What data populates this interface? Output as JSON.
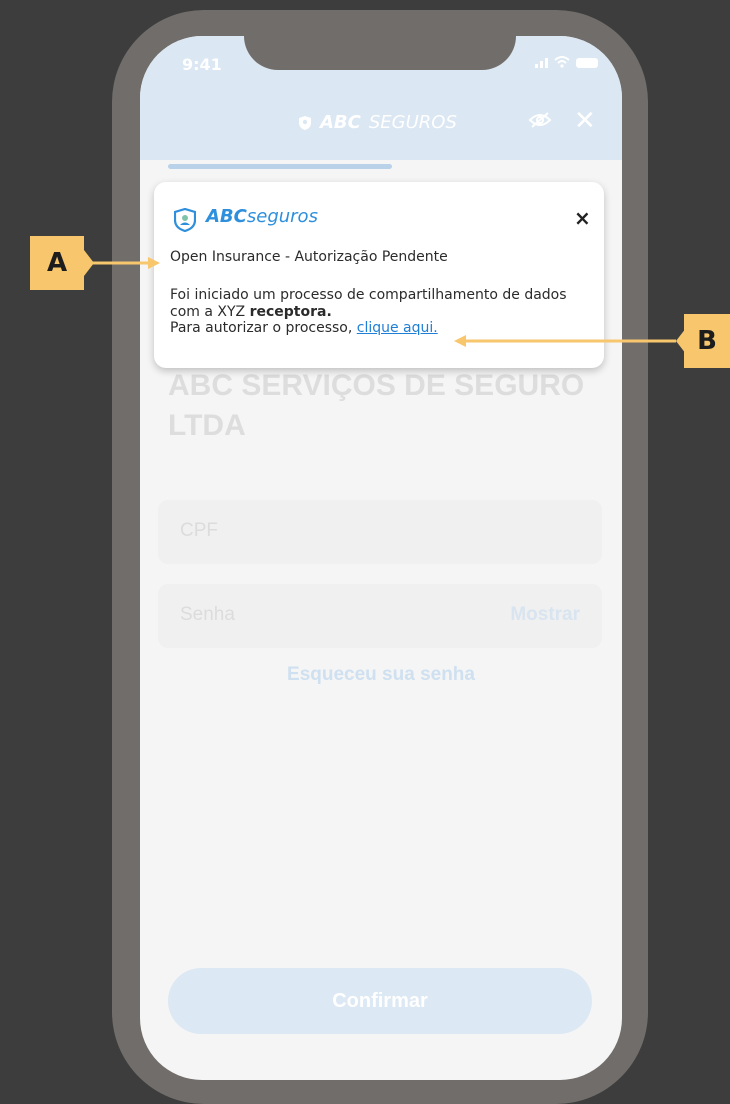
{
  "status_bar": {
    "time": "9:41"
  },
  "header": {
    "brand_bold": "ABC",
    "brand_light": "SEGUROS"
  },
  "page": {
    "title": "ABC SERVIÇOS DE SEGURO LTDA",
    "cpf_placeholder": "CPF",
    "password_placeholder": "Senha",
    "show_label": "Mostrar",
    "forgot_label": "Esqueceu sua senha",
    "confirm_label": "Confirmar"
  },
  "notification": {
    "brand_bold": "ABC",
    "brand_light": "seguros",
    "close_label": "×",
    "subject": "Open Insurance - Autorização Pendente",
    "body_line1": "Foi iniciado um processo de compartilhamento de dados",
    "body_line2_prefix": "com a XYZ ",
    "body_line2_bold": "receptora.",
    "body_line3_prefix": "Para autorizar o processo, ",
    "body_link": "clique aqui."
  },
  "annotations": {
    "a": "A",
    "b": "B"
  },
  "colors": {
    "background": "#3d3d3d",
    "phone_frame": "#716d6b",
    "annotation": "#f7c66d",
    "link": "#1f7fd6",
    "brand_blue": "#2e8fdc"
  }
}
